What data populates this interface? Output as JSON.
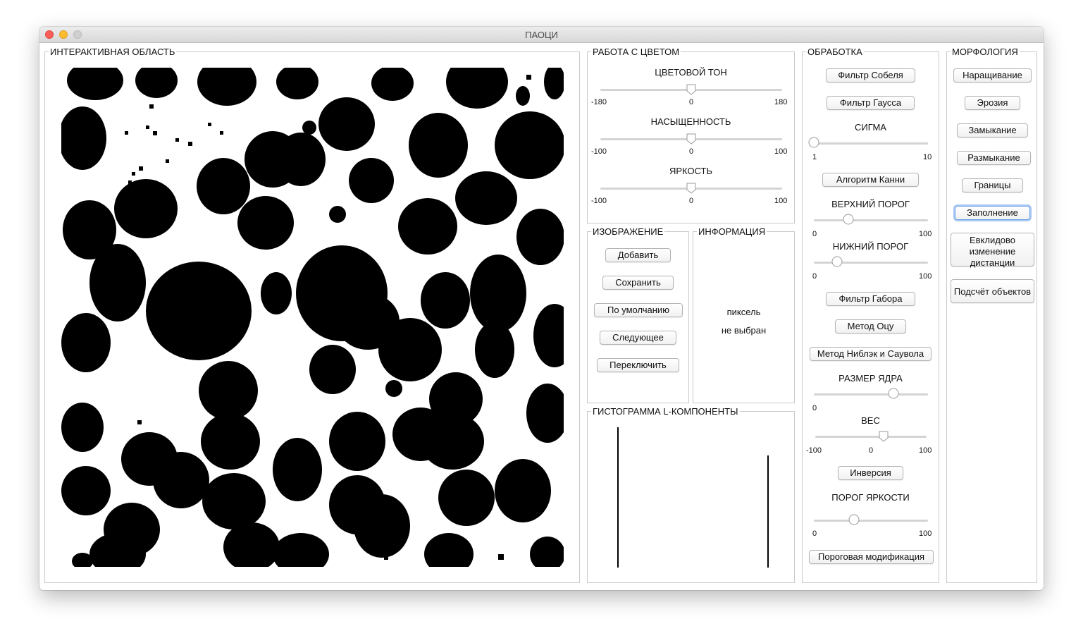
{
  "window": {
    "title": "ПАОЦИ"
  },
  "interactive": {
    "title": "ИНТЕРАКТИВНАЯ ОБЛАСТЬ"
  },
  "color": {
    "title": "РАБОТА С ЦВЕТОМ",
    "hue": {
      "label": "ЦВЕТОВОЙ ТОН",
      "min": "-180",
      "mid": "0",
      "max": "180",
      "value": 0
    },
    "saturation": {
      "label": "НАСЫЩЕННОСТЬ",
      "min": "-100",
      "mid": "0",
      "max": "100",
      "value": 0
    },
    "brightness": {
      "label": "ЯРКОСТЬ",
      "min": "-100",
      "mid": "0",
      "max": "100",
      "value": 0
    }
  },
  "image": {
    "title": "ИЗОБРАЖЕНИЕ",
    "add": "Добавить",
    "save": "Сохранить",
    "default": "По умолчанию",
    "next": "Следующее",
    "toggle": "Переключить"
  },
  "info": {
    "title": "ИНФОРМАЦИЯ",
    "line1": "пиксель",
    "line2": "не выбран"
  },
  "histogram": {
    "title": "ГИСТОГРАММА L-КОМПОНЕНТЫ"
  },
  "processing": {
    "title": "ОБРАБОТКА",
    "sobel": "Фильтр Собеля",
    "gauss": "Фильтр Гаусса",
    "sigma": {
      "label": "СИГМА",
      "min": "1",
      "max": "10",
      "value": 1
    },
    "canny": "Алгоритм Канни",
    "upper": {
      "label": "ВЕРХНИЙ ПОРОГ",
      "min": "0",
      "max": "100",
      "value": 30
    },
    "lower": {
      "label": "НИЖНИЙ ПОРОГ",
      "min": "0",
      "max": "100",
      "value": 20
    },
    "gabor": "Фильтр Габора",
    "otsu": "Метод Оцу",
    "niblack": "Метод Ниблэк и Саувола",
    "kernel": {
      "label": "РАЗМЕР ЯДРА",
      "min": "0",
      "value": 70
    },
    "weight": {
      "label": "ВЕС",
      "min": "-100",
      "mid": "0",
      "max": "100",
      "value": 20
    },
    "inversion": "Инверсия",
    "bthresh": {
      "label": "ПОРОГ ЯРКОСТИ",
      "min": "0",
      "max": "100",
      "value": 35
    },
    "thresholdmod": "Пороговая модификация"
  },
  "morphology": {
    "title": "МОРФОЛОГИЯ",
    "dilate": "Наращивание",
    "erode": "Эрозия",
    "close": "Замыкание",
    "open": "Размыкание",
    "borders": "Границы",
    "fill": "Заполнение",
    "euclid": "Евклидово изменение дистанции",
    "count": "Подсчёт объектов"
  },
  "colors": {
    "accent": "#6aa0e8",
    "border": "#c9c9c9",
    "blob": "#000000"
  }
}
